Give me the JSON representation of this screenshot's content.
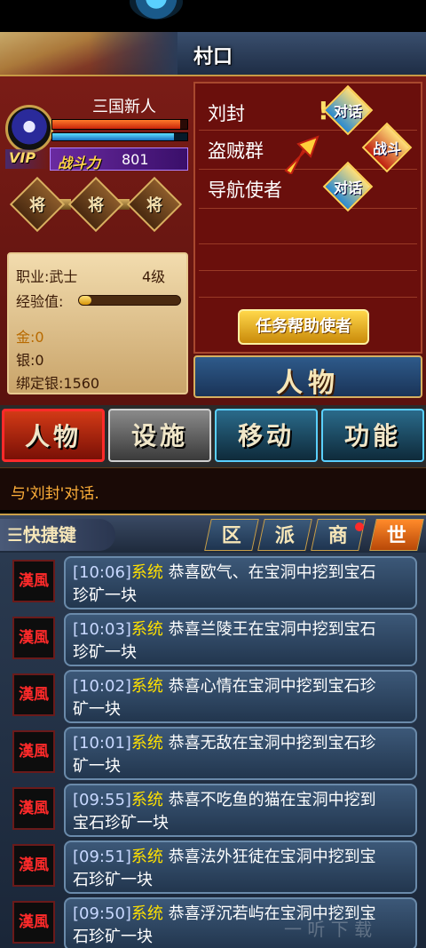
{
  "header": {
    "title": "村口"
  },
  "player": {
    "name": "三国新人",
    "hp_fraction": 0.95,
    "mp_fraction": 0.9,
    "vip_label": "VIP",
    "power_label": "战斗力",
    "power_value": "801",
    "generals": [
      "将",
      "将",
      "将"
    ]
  },
  "stats": {
    "job": "职业:武士",
    "level": "4级",
    "exp_label": "经验值:",
    "exp_fraction": 0.12,
    "gold": "金:0",
    "silver": "银:0",
    "bound_silver": "绑定银:1560"
  },
  "npcs": [
    {
      "name": "刘封",
      "action": "对话",
      "action_type": "talk",
      "mark": "!"
    },
    {
      "name": "盗贼群",
      "action": "战斗",
      "action_type": "fight"
    },
    {
      "name": "导航使者",
      "action": "对话",
      "action_type": "talk"
    }
  ],
  "helper_button": "任务帮助使者",
  "person_banner": "人物",
  "tabs": [
    "人物",
    "设施",
    "移动",
    "功能"
  ],
  "message": "与'刘封'对话.",
  "quick": {
    "label": "☰快捷键",
    "channels": [
      "区",
      "派",
      "商",
      "世"
    ]
  },
  "chat": {
    "icon_text": "漢風",
    "sender": "系统",
    "messages": [
      {
        "time": "[10:06]",
        "text": "恭喜欧气、在宝洞中挖到宝石",
        "cont": "珍矿一块"
      },
      {
        "time": "[10:03]",
        "text": "恭喜兰陵王在宝洞中挖到宝石",
        "cont": "珍矿一块"
      },
      {
        "time": "[10:02]",
        "text": "恭喜心情在宝洞中挖到宝石珍",
        "cont": "矿一块"
      },
      {
        "time": "[10:01]",
        "text": "恭喜无敌在宝洞中挖到宝石珍",
        "cont": "矿一块"
      },
      {
        "time": "[09:55]",
        "text": "恭喜不吃鱼的猫在宝洞中挖到",
        "cont": "宝石珍矿一块"
      },
      {
        "time": "[09:51]",
        "text": "恭喜法外狂徒在宝洞中挖到宝",
        "cont": "石珍矿一块"
      },
      {
        "time": "[09:50]",
        "text": "恭喜浮沉若屿在宝洞中挖到宝",
        "cont": "石珍矿一块"
      }
    ]
  },
  "watermark": "一 听 下 载"
}
